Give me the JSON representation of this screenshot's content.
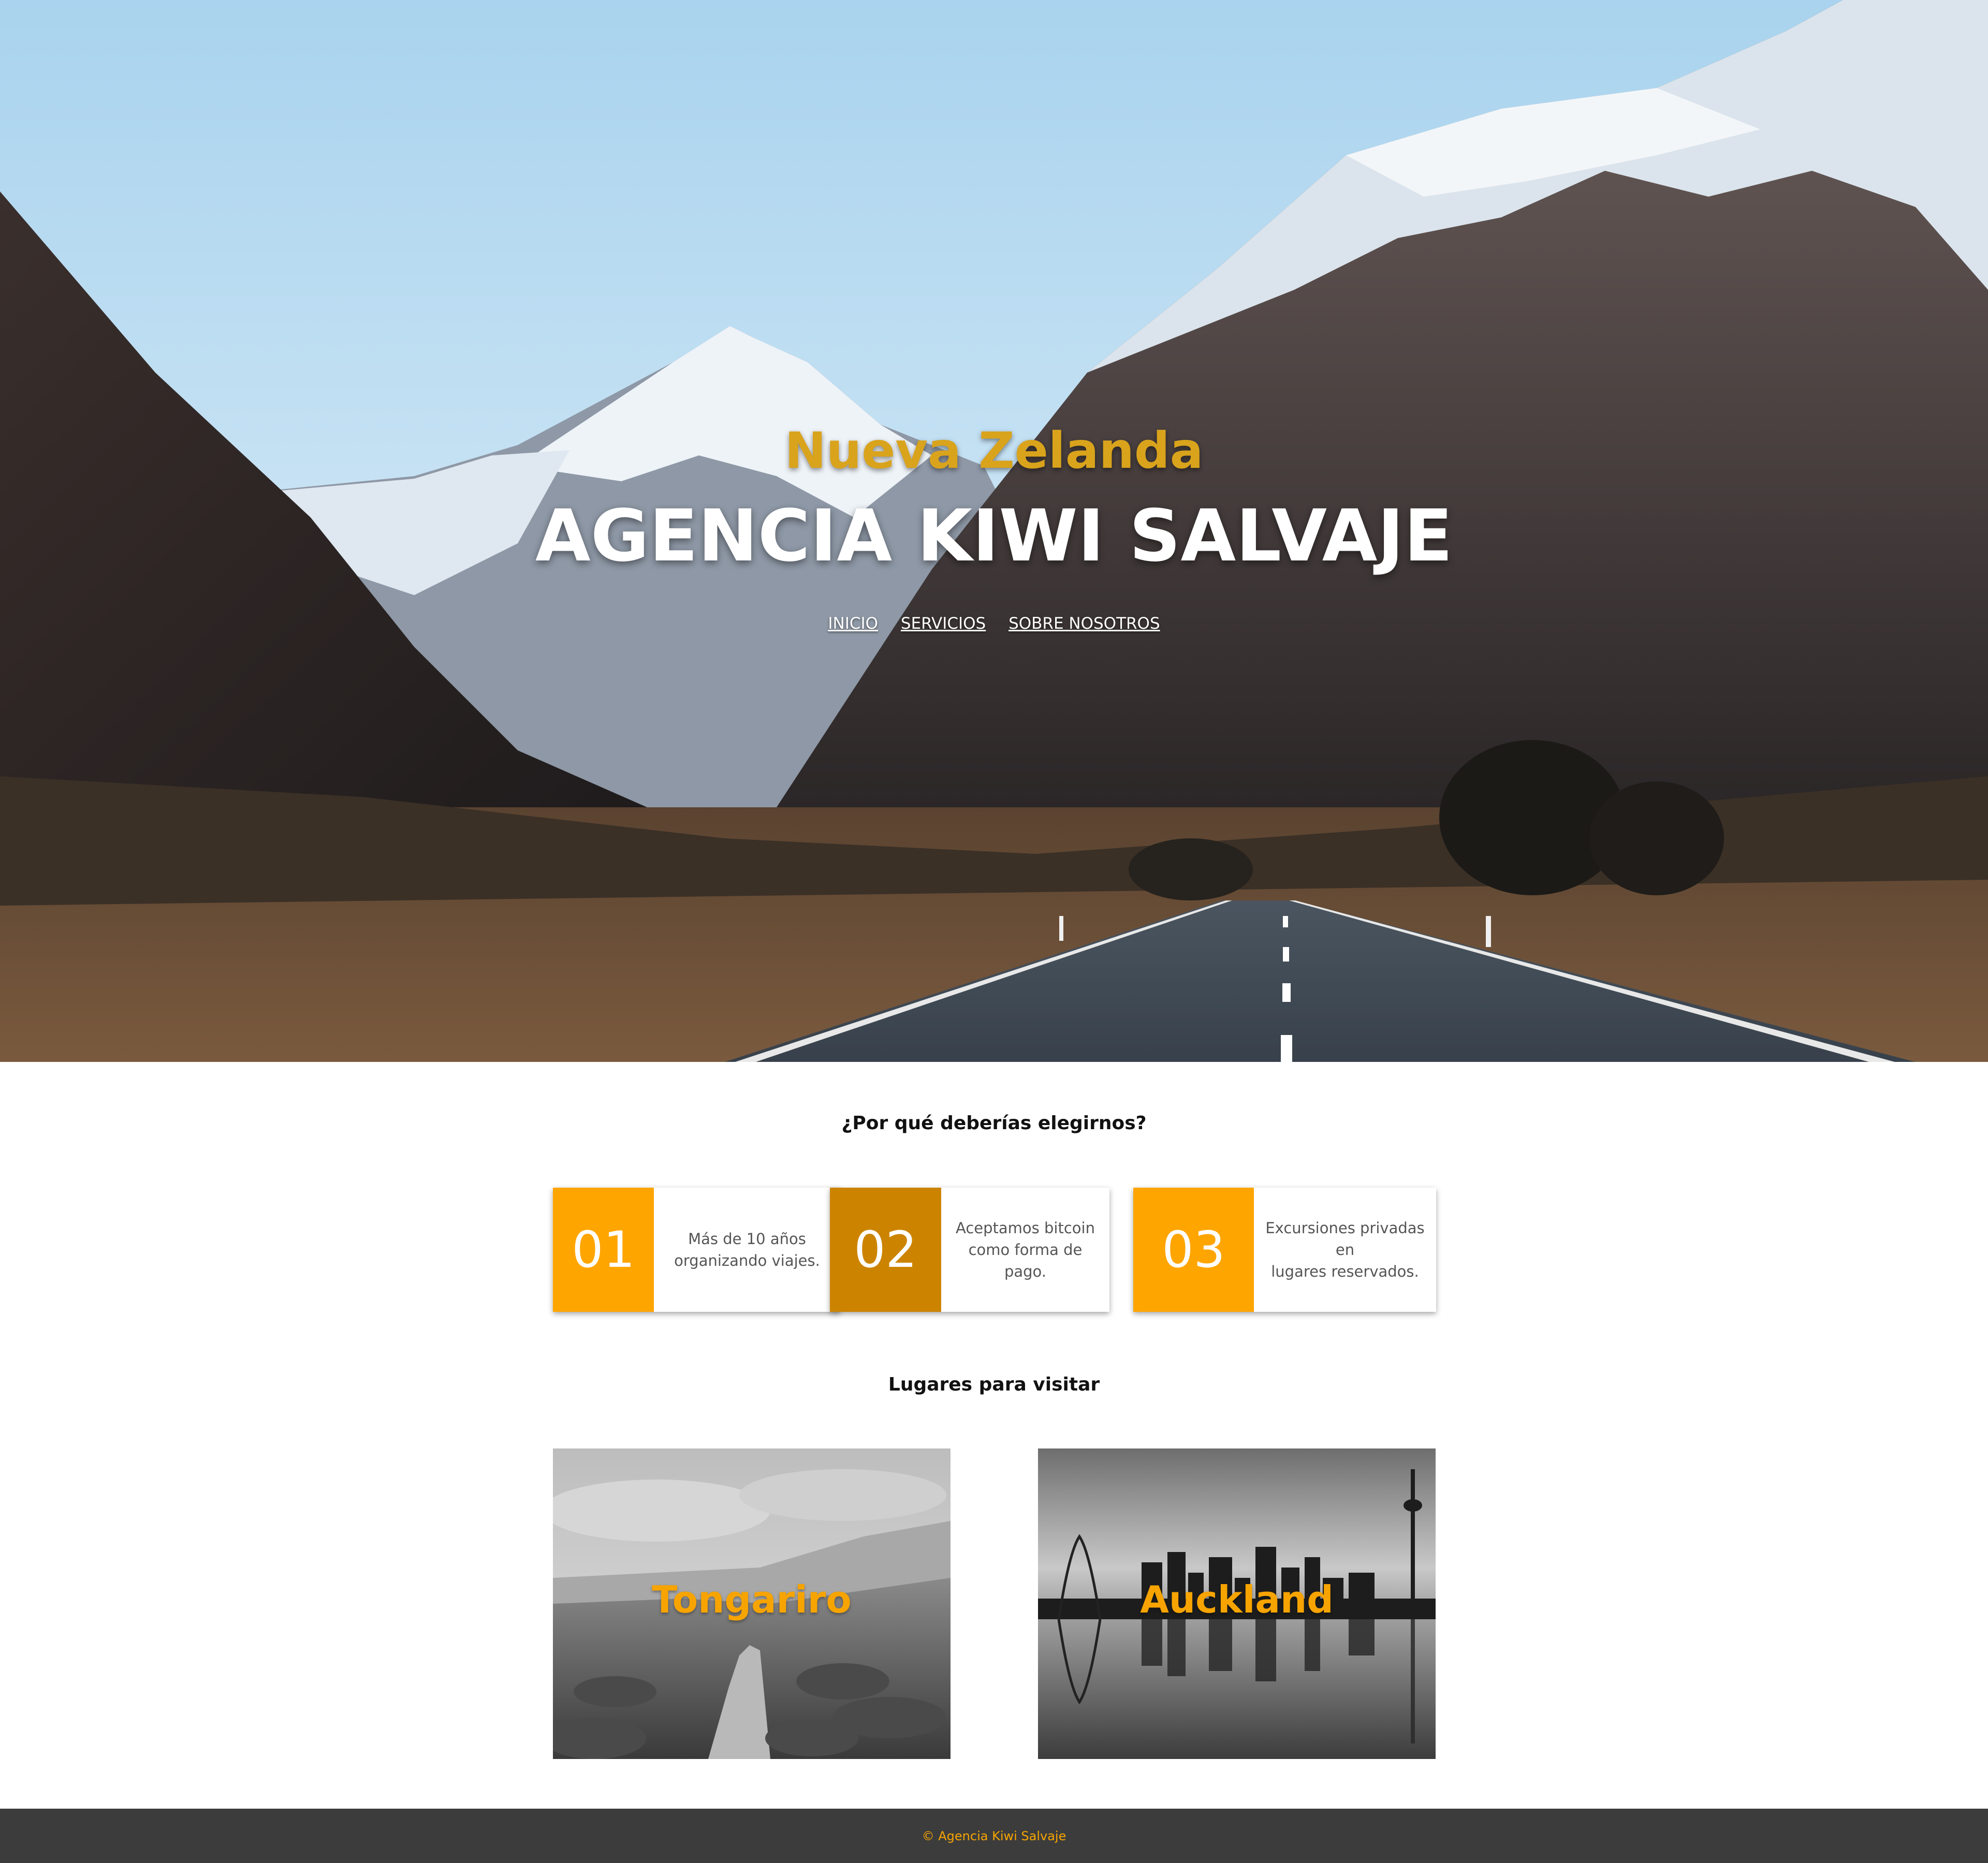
{
  "hero": {
    "subtitle": "Nueva Zelanda",
    "title": "AGENCIA KIWI SALVAJE",
    "nav": [
      "INICIO",
      "SERVICIOS",
      "SOBRE NOSOTROS"
    ]
  },
  "why": {
    "heading": "¿Por qué deberías elegirnos?",
    "cards": [
      {
        "number": "01",
        "text_line1": "Más de 10 años",
        "text_line2": "organizando viajes.",
        "color": "#ffa500"
      },
      {
        "number": "02",
        "text_line1": "Aceptamos bitcoin",
        "text_line2": "como forma de pago.",
        "color": "#cc8400"
      },
      {
        "number": "03",
        "text_line1": "Excursiones privadas en",
        "text_line2": "lugares reservados.",
        "color": "#ffa500"
      }
    ]
  },
  "places": {
    "heading": "Lugares para visitar",
    "items": [
      {
        "name": "Tongariro",
        "image": "mountain-trail-photo"
      },
      {
        "name": "Auckland",
        "image": "city-skyline-photo"
      }
    ]
  },
  "footer": {
    "text": "© Agencia Kiwi Salvaje"
  },
  "colors": {
    "accent": "#f7a400",
    "accent_dark": "#cc8400",
    "footer_bg": "#3c3c3c"
  }
}
